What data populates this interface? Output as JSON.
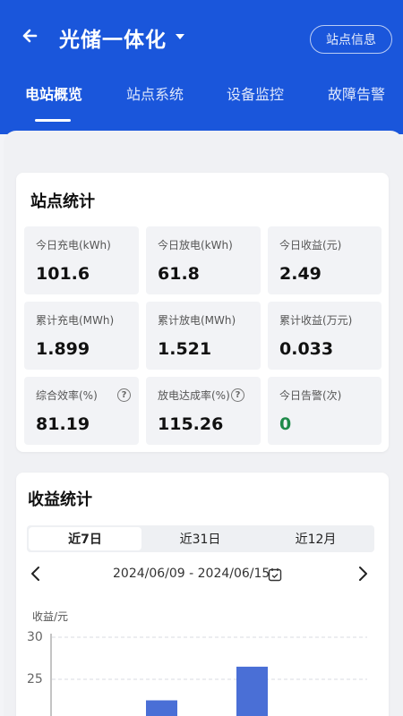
{
  "header": {
    "title": "光储一体化",
    "station_button": "站点信息",
    "tabs": [
      {
        "label": "电站概览",
        "active": true
      },
      {
        "label": "站点系统",
        "active": false
      },
      {
        "label": "设备监控",
        "active": false
      },
      {
        "label": "故障告警",
        "active": false
      }
    ]
  },
  "site_stats": {
    "title": "站点统计",
    "items": [
      {
        "label": "今日充电(kWh)",
        "value": "101.6"
      },
      {
        "label": "今日放电(kWh)",
        "value": "61.8"
      },
      {
        "label": "今日收益(元)",
        "value": "2.49"
      },
      {
        "label": "累计充电(MWh)",
        "value": "1.899"
      },
      {
        "label": "累计放电(MWh)",
        "value": "1.521"
      },
      {
        "label": "累计收益(万元)",
        "value": "0.033"
      },
      {
        "label": "综合效率(%)",
        "value": "81.19"
      },
      {
        "label": "放电达成率(%)",
        "value": "115.26"
      },
      {
        "label": "今日告警(次)",
        "value": "0"
      }
    ]
  },
  "revenue": {
    "title": "收益统计",
    "periods": [
      "近7日",
      "近31日",
      "近12月"
    ],
    "date_range": "2024/06/09 - 2024/06/15",
    "y_axis_label": "收益/元",
    "colors": {
      "bar": "#4a6fd6"
    }
  },
  "chart_data": {
    "type": "bar",
    "ylabel": "收益/元",
    "y_ticks": [
      30,
      25
    ],
    "ylim": [
      20,
      30
    ],
    "values": [
      22.5,
      26.5
    ],
    "grid": true
  },
  "colors": {
    "header": "#1a56db",
    "accent_green": "#1f8a4a"
  }
}
